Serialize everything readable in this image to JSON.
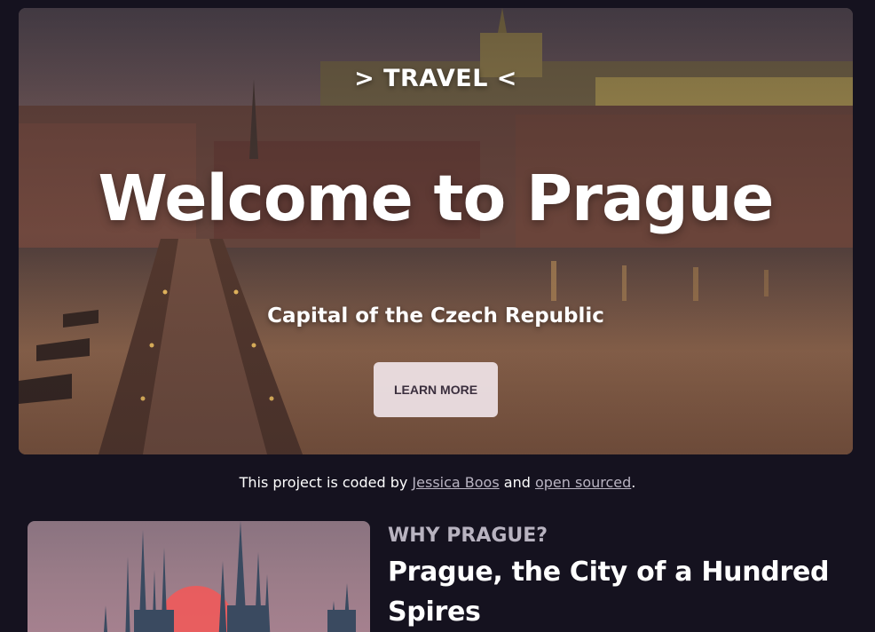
{
  "hero": {
    "eyebrow": "> TRAVEL <",
    "title": "Welcome to Prague",
    "subtitle": "Capital of the Czech Republic",
    "button_label": "LEARN MORE"
  },
  "credit": {
    "prefix": "This project is coded by ",
    "author_link": "Jessica Boos",
    "middle": " and ",
    "source_link": "open sourced",
    "suffix": "."
  },
  "why_section": {
    "eyebrow": "WHY PRAGUE?",
    "title": "Prague, the City of a Hundred Spires"
  },
  "colors": {
    "page_background": "#15121f",
    "button_background": "#f0e4e8",
    "button_text": "#3b2f3e",
    "link": "#b9b4c2",
    "eyebrow": "#b8b3c0",
    "sun": "#ef5a5a"
  }
}
